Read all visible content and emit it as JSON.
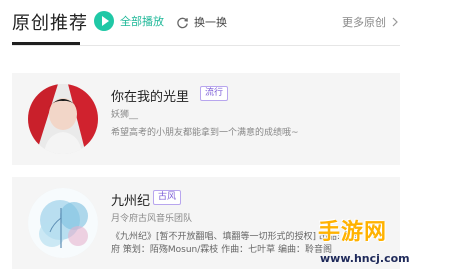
{
  "header": {
    "title": "原创推荐",
    "play_all_label": "全部播放",
    "refresh_label": "换一换",
    "more_label": "更多原创"
  },
  "cards": [
    {
      "title": "你在我的光里",
      "genre": "流行",
      "subtitle": "妖狮__",
      "description": "希望高考的小朋友都能拿到一个满意的成绩哦~"
    },
    {
      "title": "九州纪",
      "genre": "古风",
      "subtitle": "月令府古风音乐团队",
      "description": "《九州纪》[暂不开放翻唱、填翻等一切形式的授权] 出品: 月令",
      "credits": "府 策划：陌殇Mosun/霖枝 作曲：七叶草 编曲：聆音阁"
    }
  ],
  "watermark": {
    "logo": "手游网",
    "url": "www.hncj.com"
  },
  "colors": {
    "accent": "#20c8a6",
    "badge": "#7b5cd6",
    "card_bg": "#f5f5f5"
  }
}
